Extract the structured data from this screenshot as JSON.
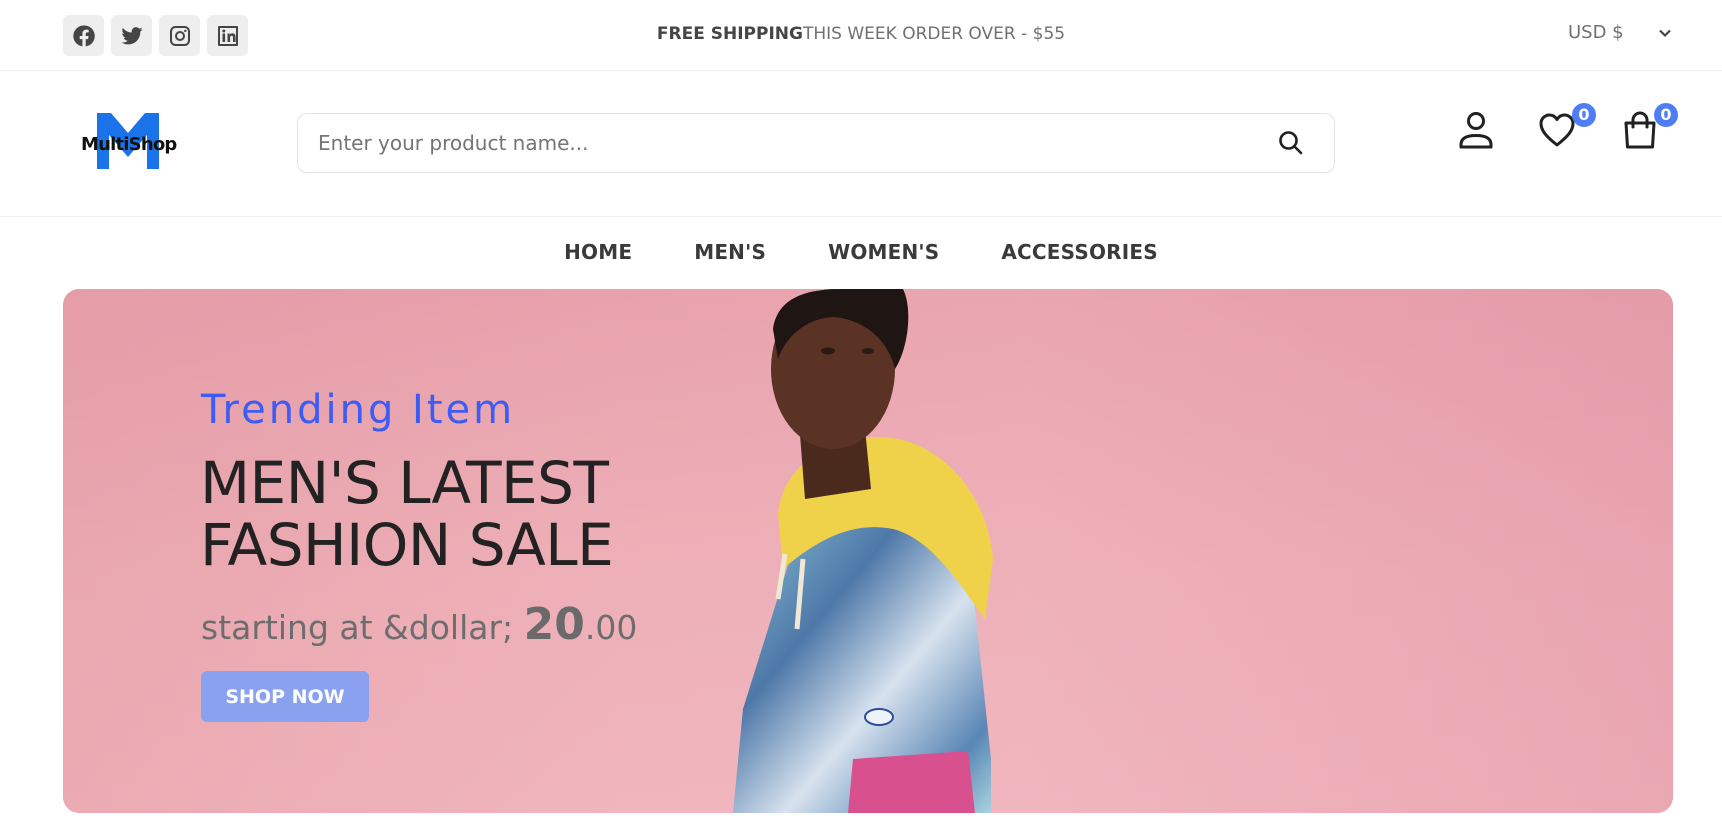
{
  "topbar": {
    "socials": [
      {
        "icon": "facebook-icon"
      },
      {
        "icon": "twitter-icon"
      },
      {
        "icon": "instagram-icon"
      },
      {
        "icon": "linkedin-icon"
      }
    ],
    "shipping_bold": "FREE SHIPPING",
    "shipping_rest": "THIS WEEK ORDER OVER - $55",
    "currency": "USD $"
  },
  "header": {
    "logo_text": "MultiShop",
    "search_placeholder": "Enter your product name...",
    "wishlist_count": "0",
    "cart_count": "0"
  },
  "nav": {
    "items": [
      "HOME",
      "MEN'S",
      "WOMEN'S",
      "ACCESSORIES"
    ]
  },
  "hero": {
    "subtitle": "Trending Item",
    "title_line1": "MEN'S LATEST",
    "title_line2": "FASHION SALE",
    "price_prefix": "starting at &dollar; ",
    "price_whole": "20",
    "price_cents": ".00",
    "cta_label": "SHOP NOW"
  },
  "colors": {
    "accent": "#4f7df5",
    "hero_subtitle": "#3d5bf5",
    "cta": "#8aa1f0",
    "hero_bg": "#eeb0b8",
    "logo_blue": "#1a73e8"
  }
}
